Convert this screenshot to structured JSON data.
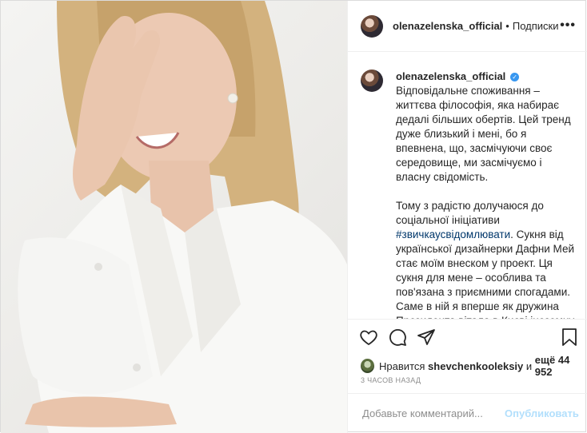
{
  "header": {
    "username": "olenazelenska_official",
    "separator": "•",
    "follow_label": "Подписки",
    "more_icon": "ellipsis-icon"
  },
  "caption": {
    "username": "olenazelenska_official",
    "verified": true,
    "paragraph1": "Відповідальне споживання – життєва філософія, яка набирає дедалі більших обертів. Цей тренд дуже близький і мені, бо я впевнена, що, засмічуючи своє середовище, ми засмічуємо і власну свідомість.",
    "paragraph2_before": "Тому з радістю долучаюся до соціальної ініціативи ",
    "hashtag": "#звичкаусвідомлювати",
    "paragraph2_after": ". Сукня від української дизайнерки Дафни Мей стає моїм внеском у проект. Ця сукня для мене – особлива та пов'язана з приємними спогадами. Саме в ній я вперше як дружина Президента вітала в Києві іноземну гостю – дружину прем'єр-міністра Ізраїлю Сару Нетаньяху."
  },
  "actions": {
    "like_icon": "heart-icon",
    "comment_icon": "comment-icon",
    "share_icon": "paper-plane-icon",
    "save_icon": "bookmark-icon"
  },
  "likes": {
    "prefix": "Нравится",
    "user": "shevchenkooleksiy",
    "middle": "и",
    "count": "ещё 44 952"
  },
  "timestamp": "3 ЧАСОВ НАЗАД",
  "comment": {
    "placeholder": "Добавьте комментарий...",
    "post_label": "Опубликовать"
  },
  "colors": {
    "border": "#dbdbdb",
    "verified": "#3897f0",
    "hashtag": "#00376b",
    "post_disabled": "#b2dffc"
  }
}
